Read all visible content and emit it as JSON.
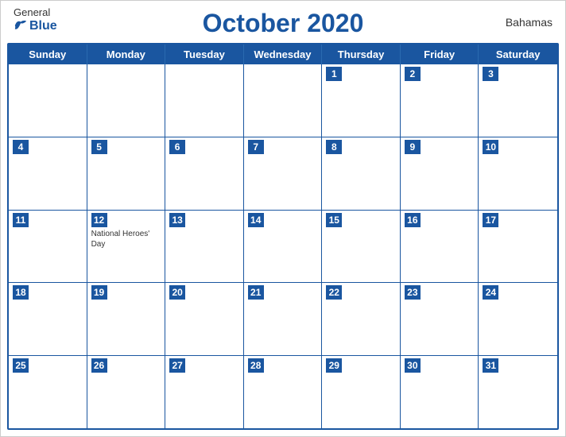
{
  "header": {
    "logo": {
      "general": "General",
      "blue": "Blue"
    },
    "title": "October 2020",
    "country": "Bahamas"
  },
  "dayHeaders": [
    "Sunday",
    "Monday",
    "Tuesday",
    "Wednesday",
    "Thursday",
    "Friday",
    "Saturday"
  ],
  "weeks": [
    [
      {
        "day": "",
        "empty": true
      },
      {
        "day": "",
        "empty": true
      },
      {
        "day": "",
        "empty": true
      },
      {
        "day": "",
        "empty": true
      },
      {
        "day": "1"
      },
      {
        "day": "2"
      },
      {
        "day": "3"
      }
    ],
    [
      {
        "day": "4"
      },
      {
        "day": "5"
      },
      {
        "day": "6"
      },
      {
        "day": "7"
      },
      {
        "day": "8"
      },
      {
        "day": "9"
      },
      {
        "day": "10"
      }
    ],
    [
      {
        "day": "11"
      },
      {
        "day": "12",
        "event": "National Heroes' Day"
      },
      {
        "day": "13"
      },
      {
        "day": "14"
      },
      {
        "day": "15"
      },
      {
        "day": "16"
      },
      {
        "day": "17"
      }
    ],
    [
      {
        "day": "18"
      },
      {
        "day": "19"
      },
      {
        "day": "20"
      },
      {
        "day": "21"
      },
      {
        "day": "22"
      },
      {
        "day": "23"
      },
      {
        "day": "24"
      }
    ],
    [
      {
        "day": "25"
      },
      {
        "day": "26"
      },
      {
        "day": "27"
      },
      {
        "day": "28"
      },
      {
        "day": "29"
      },
      {
        "day": "30"
      },
      {
        "day": "31"
      }
    ]
  ]
}
